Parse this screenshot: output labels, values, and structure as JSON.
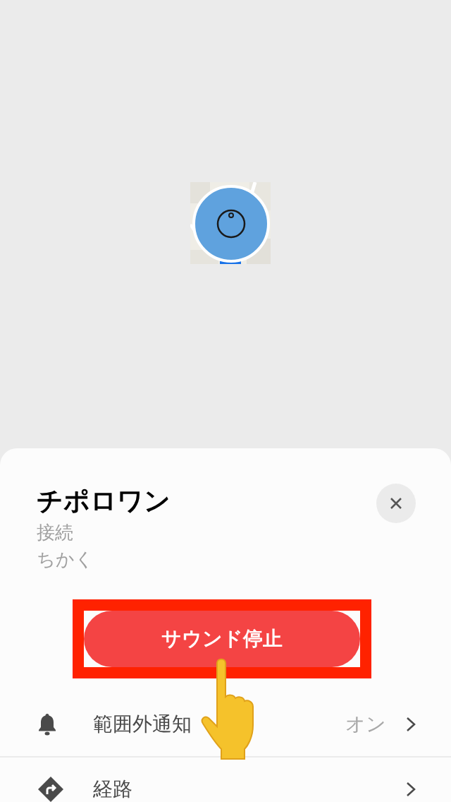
{
  "device": {
    "name": "チポロワン",
    "status": "接続",
    "distance": "ちかく"
  },
  "sound_button": {
    "label": "サウンド停止",
    "highlighted": true
  },
  "rows": [
    {
      "kind": "notification",
      "label": "範囲外通知",
      "value": "オン"
    },
    {
      "kind": "route",
      "label": "経路"
    }
  ]
}
